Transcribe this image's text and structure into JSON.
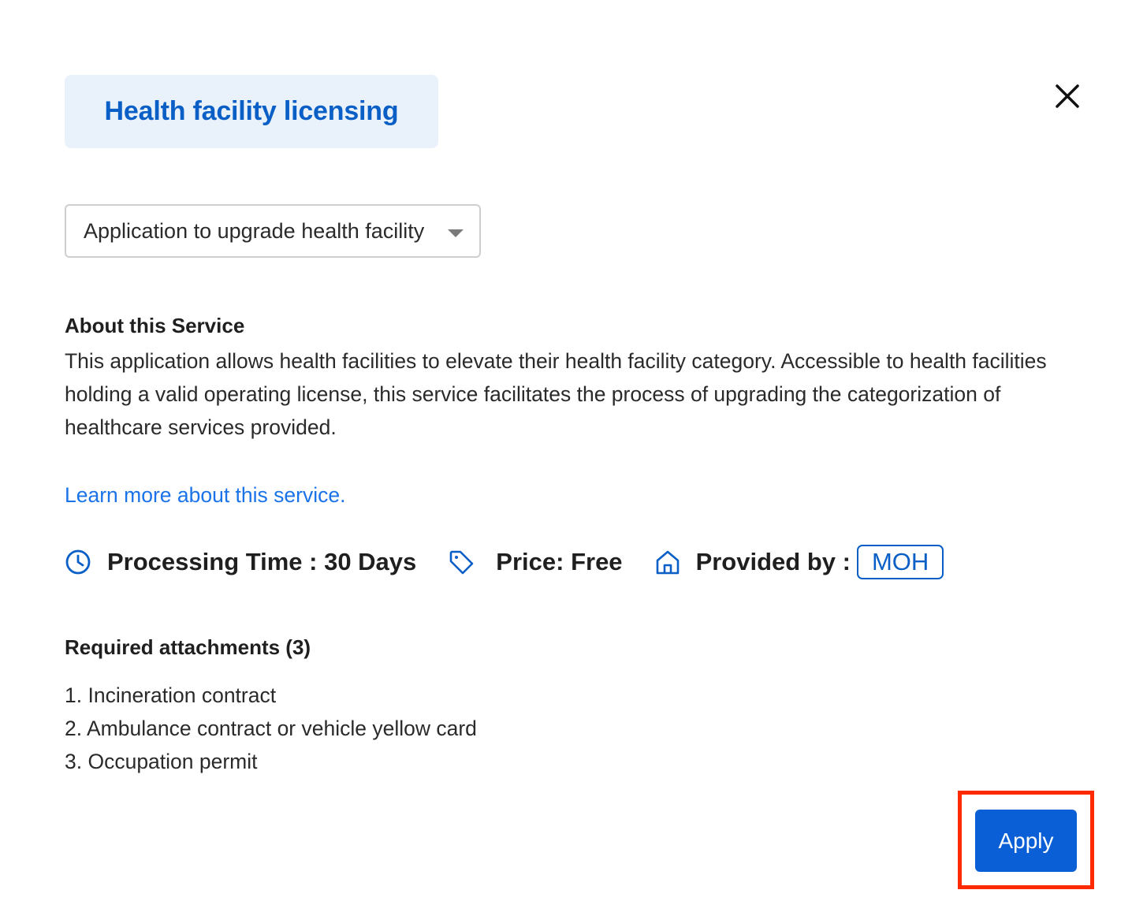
{
  "header": {
    "title": "Health facility licensing",
    "close_icon": "close-icon"
  },
  "service_select": {
    "selected": "Application to upgrade health facility",
    "caret_icon": "chevron-down-icon"
  },
  "about": {
    "heading": "About this Service",
    "description": "This application allows health facilities to elevate their health facility category. Accessible to health facilities holding a valid operating license, this service facilitates the process of upgrading the categorization of healthcare services provided.",
    "learn_more": "Learn more about this service."
  },
  "meta": {
    "processing_time": "Processing Time : 30 Days",
    "processing_icon": "clock-icon",
    "price": "Price: Free",
    "price_icon": "tag-icon",
    "provided_by_label": "Provided by :",
    "provider_icon": "home-icon",
    "provider": "MOH"
  },
  "attachments": {
    "heading": "Required attachments (3)",
    "items": [
      "1. Incineration contract",
      "2. Ambulance contract or vehicle yellow card",
      "3. Occupation permit"
    ]
  },
  "actions": {
    "apply_label": "Apply"
  },
  "colors": {
    "brand": "#0a5fc7",
    "link": "#1a73e8",
    "highlight": "#ff2a00",
    "title_bg": "#e9f1fb"
  }
}
